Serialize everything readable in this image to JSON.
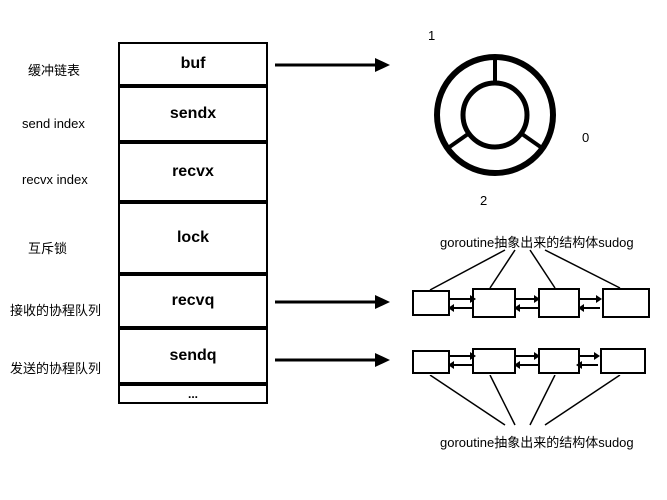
{
  "table": {
    "rows": [
      {
        "label": "缓冲链表",
        "value": "buf"
      },
      {
        "label": "send index",
        "value": "sendx"
      },
      {
        "label": "recvx index",
        "value": "recvx"
      },
      {
        "label": "互斥锁",
        "value": "lock"
      },
      {
        "label": "接收的协程队列",
        "value": "recvq"
      },
      {
        "label": "发送的协程队列",
        "value": "sendq"
      },
      {
        "label": "",
        "value": "..."
      }
    ]
  },
  "ring": {
    "labels": [
      "1",
      "0",
      "2"
    ]
  },
  "sudog": {
    "top_caption": "goroutine抽象出来的结构体sudog",
    "bottom_caption": "goroutine抽象出来的结构体sudog"
  }
}
